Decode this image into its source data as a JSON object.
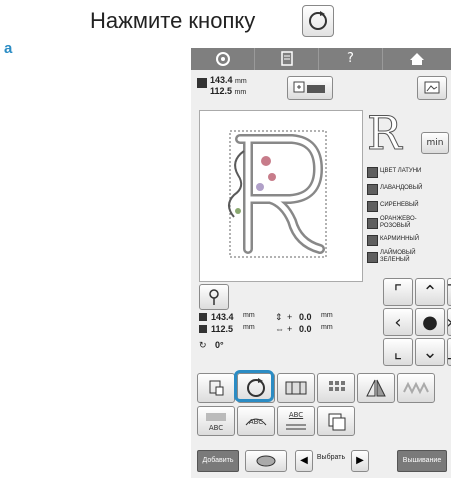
{
  "instruction": {
    "text": "Нажмите кнопку"
  },
  "step_label": "a",
  "topbar": {
    "help_label": "?"
  },
  "size_display": {
    "height": "143.4",
    "width": "112.5",
    "unit": "mm"
  },
  "preview_letter": "R",
  "min_label": "min",
  "threads": [
    "ЦВЕТ ЛАТУНИ",
    "ЛАВАНДОВЫЙ",
    "СИРЕНЕВЫЙ",
    "ОРАНЖЕВО-РОЗОВЫЙ",
    "КАРМИННЫЙ",
    "ЛАЙМОВЫЙ ЗЕЛЕНЫЙ"
  ],
  "info": {
    "height": "143.4",
    "width": "112.5",
    "unit": "mm",
    "offset_y_sign": "+",
    "offset_y": "0.0",
    "offset_x_sign": "+",
    "offset_x": "0.0",
    "rotation": "0°"
  },
  "edit_labels": {
    "abc1": "ABC",
    "abc2": "ABC",
    "abc3": "ABC"
  },
  "bottom": {
    "add_label": "Добавить",
    "select_label": "Выбрать",
    "embroider_label": "Вышивание"
  },
  "colors": {
    "highlight": "#2b8cc4",
    "topbar": "#7f7f7f",
    "thread_chip": "#5f5f5f"
  }
}
